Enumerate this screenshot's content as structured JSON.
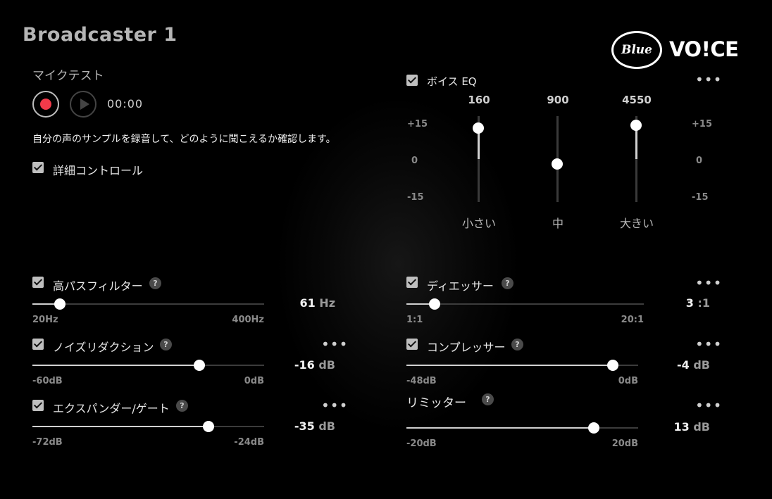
{
  "app_title": "Broadcaster 1",
  "logo": {
    "mark": "Blue",
    "text": "VO!CE"
  },
  "mic_test": {
    "label": "マイクテスト",
    "time": "00:00",
    "description": "自分の声のサンプルを録音して、どのように聞こえるか確認します。"
  },
  "advanced_controls": {
    "label": "詳細コントロール",
    "checked": true
  },
  "voice_eq": {
    "label": "ボイス EQ",
    "checked": true,
    "scale": {
      "top": "+15",
      "mid": "0",
      "bottom": "-15"
    },
    "bands": [
      {
        "freq": "160",
        "name": "小さい",
        "value": 12
      },
      {
        "freq": "900",
        "name": "中",
        "value": -2
      },
      {
        "freq": "4550",
        "name": "大きい",
        "value": 13
      }
    ]
  },
  "filters": {
    "high_pass": {
      "label": "高パスフィルター",
      "value": "61",
      "unit": "Hz",
      "min": "20Hz",
      "max": "400Hz",
      "fraction": 0.12,
      "checked": true
    },
    "noise_reduction": {
      "label": "ノイズリダクション",
      "value": "-16",
      "unit": "dB",
      "min": "-60dB",
      "max": "0dB",
      "fraction": 0.72,
      "checked": true
    },
    "expander_gate": {
      "label": "エクスパンダー/ゲート",
      "value": "-35",
      "unit": "dB",
      "min": "-72dB",
      "max": "-24dB",
      "fraction": 0.76,
      "checked": true
    },
    "de_esser": {
      "label": "ディエッサー",
      "value": "3",
      "unit": ":1",
      "min": "1:1",
      "max": "20:1",
      "fraction": 0.12,
      "checked": true
    },
    "compressor": {
      "label": "コンプレッサー",
      "value": "-4",
      "unit": "dB",
      "min": "-48dB",
      "max": "0dB",
      "fraction": 0.89,
      "checked": true
    },
    "limiter": {
      "label": "リミッター",
      "value": "13",
      "unit": "dB",
      "min": "-20dB",
      "max": "20dB",
      "fraction": 0.81
    }
  },
  "help_glyph": "?",
  "more_glyph": "•••",
  "colors": {
    "background": "#000000",
    "record": "#f23a4a",
    "knob": "#ffffff"
  }
}
